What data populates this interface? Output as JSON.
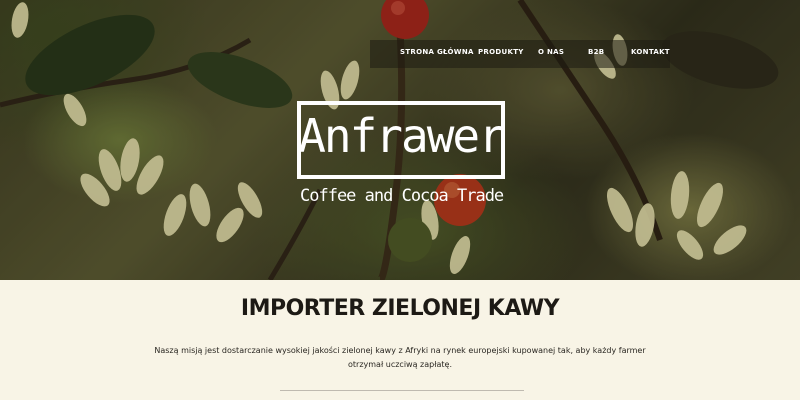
{
  "nav": {
    "items": [
      {
        "label": "STRONA GŁÓWNA"
      },
      {
        "label": "PRODUKTY"
      },
      {
        "label": "O NAS"
      },
      {
        "label": "B2B"
      },
      {
        "label": "KONTAKT"
      }
    ]
  },
  "hero": {
    "logo_title": "Anfrawer",
    "logo_subtitle": "Coffee and Cocoa Trade"
  },
  "main": {
    "heading": "IMPORTER ZIELONEJ KAWY",
    "mission": "Naszą misją jest dostarczanie wysokiej jakości zielonej kawy z Afryki na rynek europejski kupowanej tak, aby każdy farmer otrzymał uczciwą zapłatę."
  },
  "colors": {
    "background": "#f8f4e6",
    "heading": "#1d1a15",
    "logo": "#ffffff"
  }
}
